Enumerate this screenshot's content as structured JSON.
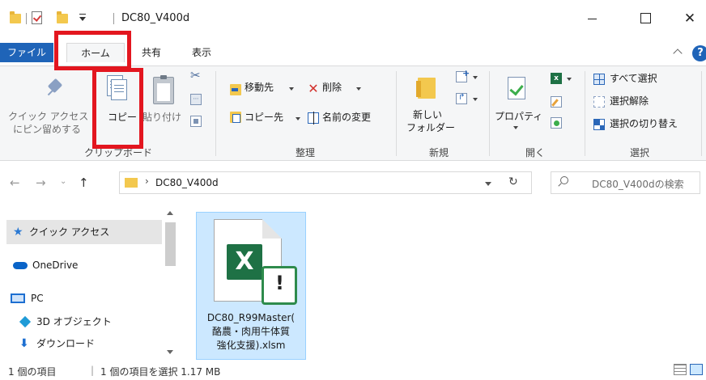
{
  "window": {
    "title": "DC80_V400d",
    "minimize_icon": "minimize-icon",
    "maximize_icon": "maximize-icon",
    "close_glyph": "✕"
  },
  "tabs": {
    "file": "ファイル",
    "home": "ホーム",
    "share": "共有",
    "view": "表示",
    "help": "?"
  },
  "ribbon": {
    "clipboard": {
      "group_label": "クリップボード",
      "pin_line1": "クイック アクセス",
      "pin_line2": "にピン留めする",
      "copy": "コピー",
      "paste": "貼り付け"
    },
    "organize": {
      "group_label": "整理",
      "move_to": "移動先",
      "delete": "削除",
      "copy_to": "コピー先",
      "rename": "名前の変更"
    },
    "new": {
      "group_label": "新規",
      "new_folder_line1": "新しい",
      "new_folder_line2": "フォルダー"
    },
    "open": {
      "group_label": "開く",
      "properties": "プロパティ"
    },
    "select": {
      "group_label": "選択",
      "select_all": "すべて選択",
      "select_none": "選択解除",
      "invert_selection": "選択の切り替え"
    }
  },
  "address": {
    "path": "DC80_V400d",
    "search_placeholder": "DC80_V400dの検索"
  },
  "nav_pane": {
    "items": [
      {
        "label": "クイック アクセス",
        "icon": "star-icon",
        "selected": true
      },
      {
        "label": "OneDrive",
        "icon": "cloud-icon"
      },
      {
        "label": "PC",
        "icon": "computer-icon"
      },
      {
        "label": "3D オブジェクト",
        "icon": "cube-icon"
      },
      {
        "label": "ダウンロード",
        "icon": "download-icon"
      }
    ]
  },
  "files": [
    {
      "name_line1": "DC80_R99Master(",
      "name_line2": "酪農・肉用牛体質",
      "name_line3": "強化支援).xlsm",
      "icon": "excel-macro-icon",
      "selected": true
    }
  ],
  "status": {
    "item_count": "1 個の項目",
    "selected_info": "1 個の項目を選択  1.17 MB"
  },
  "colors": {
    "accent": "#1f64b8",
    "highlight": "#e3161f",
    "selection": "#cce8ff",
    "excel": "#1e7145"
  }
}
